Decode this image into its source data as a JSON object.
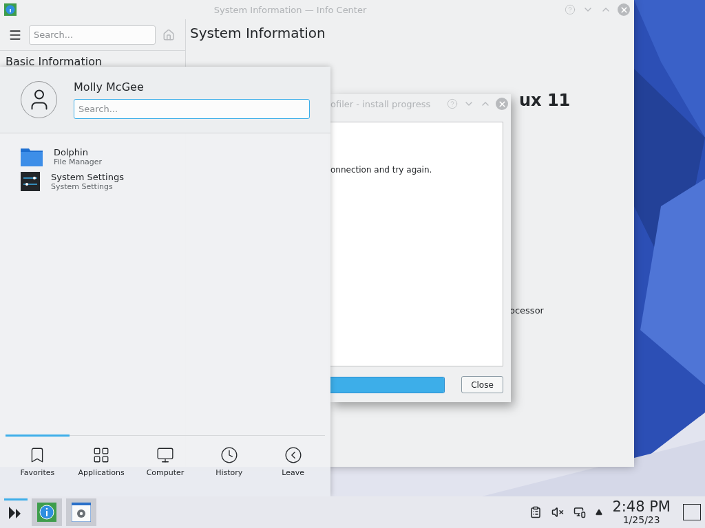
{
  "info_center": {
    "title": "System Information — Info Center",
    "search": {
      "placeholder": "Search..."
    },
    "sidebar_heading": "Basic Information",
    "page_title": "System Information",
    "os_fragment": "ux 11",
    "row_fragment": "ocessor"
  },
  "dialog": {
    "title": "ofiler - install progress",
    "log_line": "onnection and try again.",
    "progress": {
      "level": 1
    },
    "close_button": "Close"
  },
  "launcher": {
    "user": "Molly McGee",
    "search": {
      "placeholder": "Search..."
    },
    "apps": [
      {
        "name": "Dolphin",
        "description": "File Manager",
        "kind": "folder"
      },
      {
        "name": "System Settings",
        "description": "System Settings",
        "kind": "settings"
      }
    ],
    "tabs": [
      {
        "label": "Favorites",
        "kind": "bookmark",
        "selected": true
      },
      {
        "label": "Applications",
        "kind": "grid",
        "selected": false
      },
      {
        "label": "Computer",
        "kind": "monitor",
        "selected": false
      },
      {
        "label": "History",
        "kind": "clock",
        "selected": false
      },
      {
        "label": "Leave",
        "kind": "leave",
        "selected": false
      }
    ]
  },
  "taskbar": {
    "tasks": [
      {
        "kind": "info"
      },
      {
        "kind": "settings"
      }
    ],
    "clock": {
      "time": "2:48 PM",
      "date": "1/25/23"
    }
  }
}
